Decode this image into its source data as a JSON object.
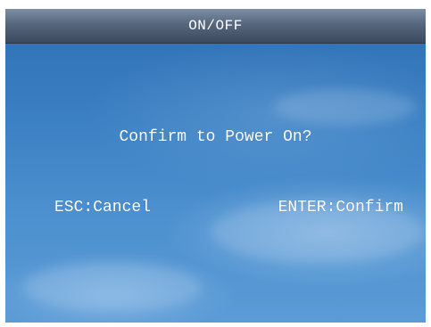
{
  "dialog": {
    "title": "ON/OFF",
    "prompt": "Confirm to Power On?",
    "cancel_label": "ESC:Cancel",
    "confirm_label": "ENTER:Confirm"
  },
  "colors": {
    "title_bar": "#56667c",
    "background_top": "#2f6fb4",
    "background_bottom": "#5b9bd6",
    "text": "#ffffff"
  }
}
